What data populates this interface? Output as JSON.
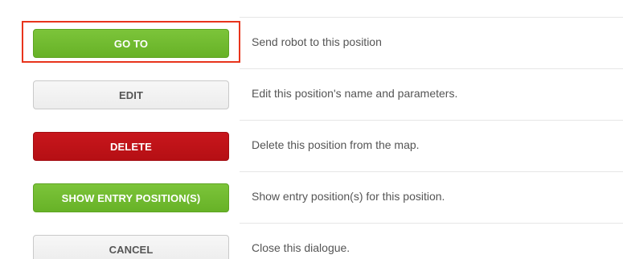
{
  "actions": [
    {
      "button_label": "GO TO",
      "description": "Send robot to this position",
      "style": "green"
    },
    {
      "button_label": "EDIT",
      "description": "Edit this position's name and parameters.",
      "style": "grey"
    },
    {
      "button_label": "DELETE",
      "description": "Delete this position from the map.",
      "style": "red"
    },
    {
      "button_label": "SHOW ENTRY POSITION(S)",
      "description": "Show entry position(s) for this position.",
      "style": "green"
    },
    {
      "button_label": "CANCEL",
      "description": "Close this dialogue.",
      "style": "grey"
    }
  ],
  "highlight": {
    "target": "GO TO",
    "color": "#e8341c"
  },
  "colors": {
    "green": "#6cb52b",
    "red": "#bf1318",
    "grey": "#f0f0f0",
    "text": "#555555"
  }
}
